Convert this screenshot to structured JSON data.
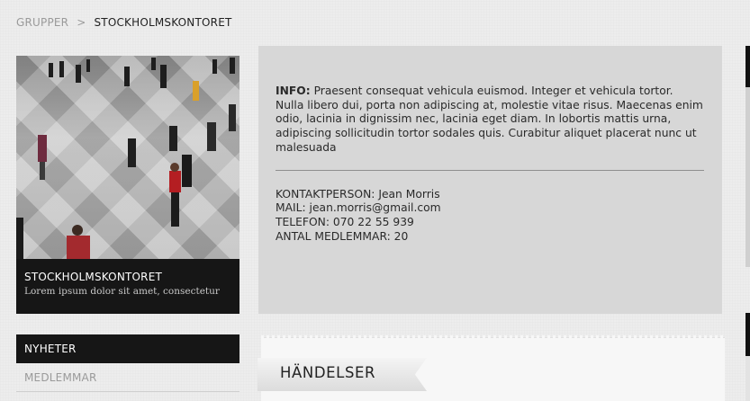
{
  "breadcrumb": {
    "root": "GRUPPER",
    "separator": ">",
    "current": "STOCKHOLMSKONTORET"
  },
  "group_card": {
    "title": "STOCKHOLMSKONTORET",
    "subtitle": "Lorem ipsum dolor sit amet, consectetur"
  },
  "info": {
    "label": "INFO:",
    "text": "Praesent consequat vehicula euismod. Integer et vehicula tortor. Nulla libero dui, porta non adipiscing at, molestie vitae risus. Maecenas enim odio, lacinia in dignissim nec, lacinia eget diam. In lobortis mattis urna, adipiscing sollicitudin tortor sodales quis. Curabitur aliquet placerat nunc ut malesuada"
  },
  "contact": {
    "person": "KONTAKTPERSON: Jean Morris",
    "mail": "MAIL: jean.morris@gmail.com",
    "phone": "TELEFON: 070 22 55 939",
    "members": "ANTAL MEDLEMMAR: 20"
  },
  "nav": {
    "items": [
      {
        "label": "NYHETER",
        "active": true
      },
      {
        "label": "MEDLEMMAR",
        "active": false
      }
    ]
  },
  "events": {
    "heading": "HÄNDELSER"
  }
}
